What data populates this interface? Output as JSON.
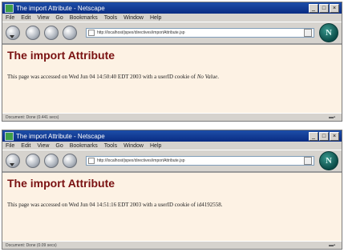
{
  "windows": [
    {
      "title": "The import Attribute - Netscape",
      "menu": [
        "File",
        "Edit",
        "View",
        "Go",
        "Bookmarks",
        "Tools",
        "Window",
        "Help"
      ],
      "url": "http://localhost/jspex/directives/importAttribute.jsp",
      "heading": "The import Attribute",
      "text_prefix": "This page was accessed on Wed Jun 04 14:50:40 EDT 2003 with a userID cookie of ",
      "cookie_value": "No Value",
      "text_suffix": ".",
      "status": "Document: Done (0.441 secs)"
    },
    {
      "title": "The import Attribute - Netscape",
      "menu": [
        "File",
        "Edit",
        "View",
        "Go",
        "Bookmarks",
        "Tools",
        "Window",
        "Help"
      ],
      "url": "http://localhost/jspex/directives/importAttribute.jsp",
      "heading": "The import Attribute",
      "text_prefix": "This page was accessed on Wed Jun 04 14:51:16 EDT 2003 with a userID cookie of ",
      "cookie_value": "id4192558",
      "text_suffix": ".",
      "status": "Document: Done (0.09 secs)"
    }
  ],
  "icons": {
    "back": "back-icon",
    "forward": "forward-icon",
    "reload": "reload-icon",
    "stop": "stop-icon",
    "logo": "netscape-logo-icon"
  },
  "colors": {
    "heading": "#7a1111",
    "page_background": "#fdf2e4",
    "titlebar": "#0a2c83"
  }
}
